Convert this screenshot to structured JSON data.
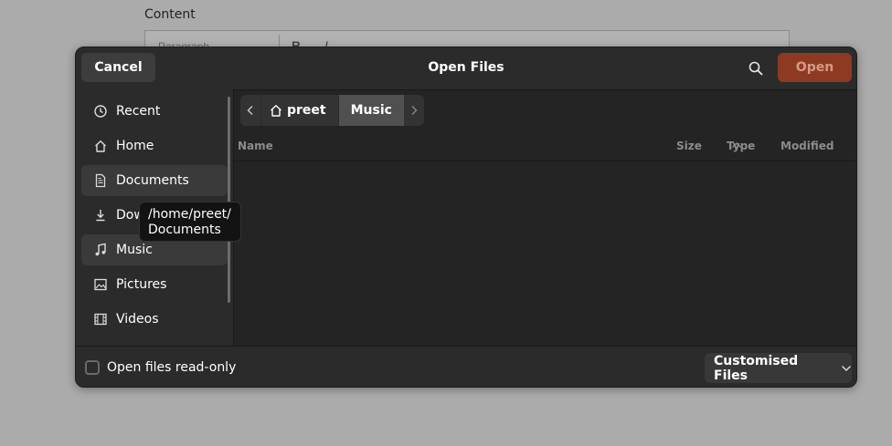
{
  "background": {
    "label": "Content",
    "toolbar_paragraph": "Paragraph",
    "toolbar_bold": "B",
    "toolbar_italic": "I"
  },
  "dialog": {
    "title": "Open Files",
    "cancel_label": "Cancel",
    "open_label": "Open",
    "search_icon": "search-icon"
  },
  "sidebar": {
    "items": [
      {
        "label": "Recent",
        "icon": "clock-icon"
      },
      {
        "label": "Home",
        "icon": "home-icon"
      },
      {
        "label": "Documents",
        "icon": "document-icon"
      },
      {
        "label": "Downloads",
        "icon": "download-icon"
      },
      {
        "label": "Music",
        "icon": "music-icon"
      },
      {
        "label": "Pictures",
        "icon": "picture-icon"
      },
      {
        "label": "Videos",
        "icon": "film-icon"
      }
    ]
  },
  "pathbar": {
    "crumbs": [
      {
        "label": "preet",
        "icon": "home-icon"
      },
      {
        "label": "Music"
      }
    ]
  },
  "columns": {
    "name": "Name",
    "size": "Size",
    "type": "Type",
    "modified": "Modified"
  },
  "footer": {
    "readonly_label": "Open files read-only",
    "readonly_checked": false,
    "filter_label": "Customised Files"
  },
  "tooltip": {
    "line1": "/home/preet/",
    "line2": "Documents"
  },
  "colors": {
    "accent": "#8e3a23",
    "dialog_bg": "#242424",
    "sidebar_bg": "#2b2b2b"
  }
}
